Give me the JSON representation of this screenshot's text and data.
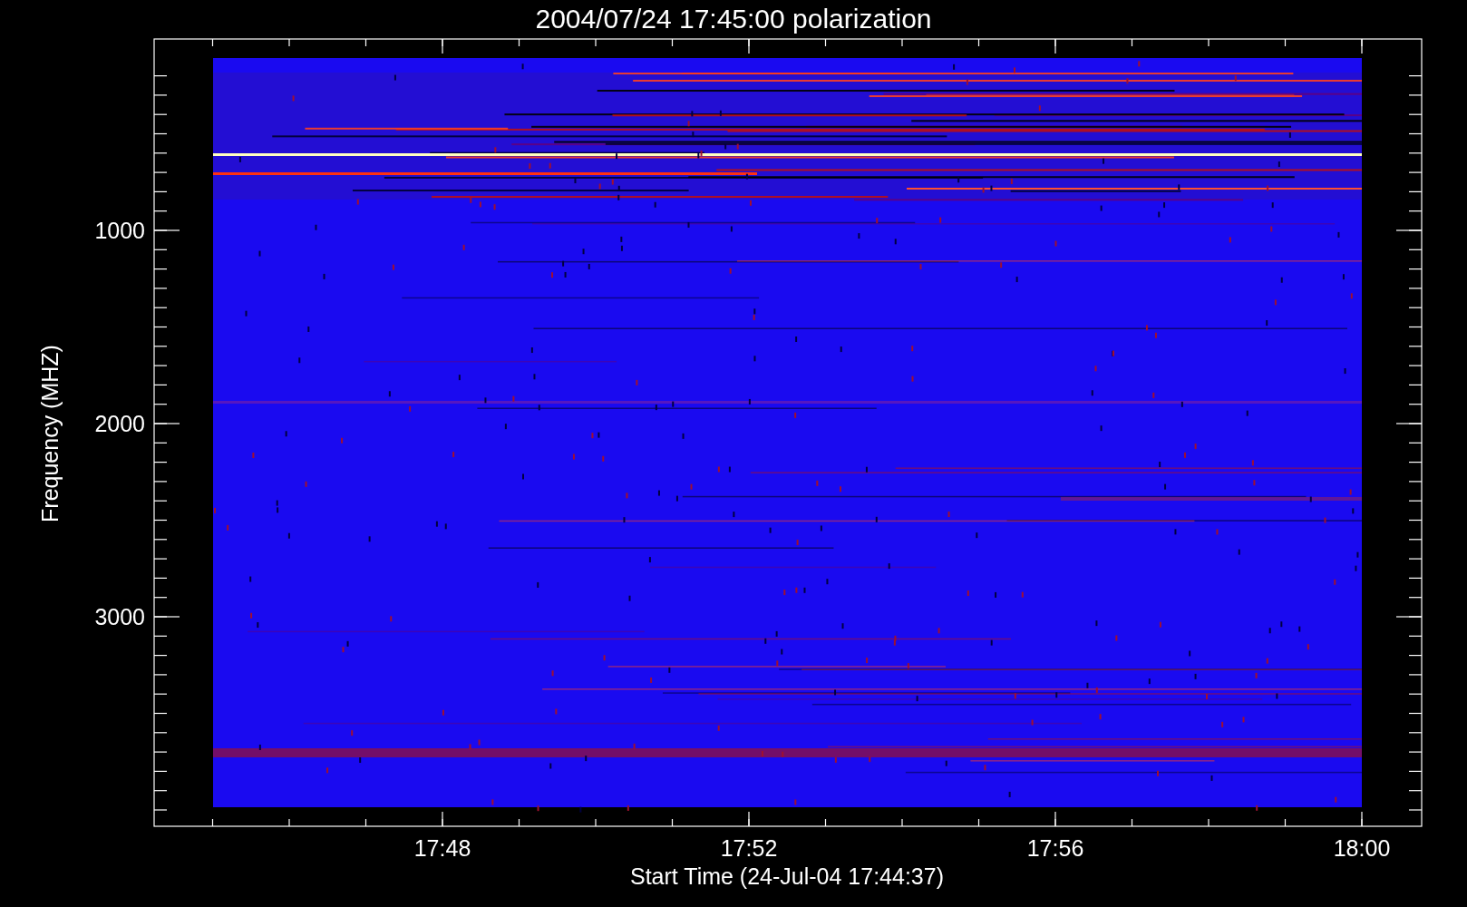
{
  "title": "2004/07/24 17:45:00 polarization",
  "y_axis": {
    "label": "Frequency (MHZ)",
    "ticks": [
      "1000",
      "2000",
      "3000"
    ]
  },
  "x_axis": {
    "label": "Start Time (24-Jul-04 17:44:37)",
    "ticks": [
      "17:48",
      "17:52",
      "17:56",
      "18:00"
    ]
  }
}
